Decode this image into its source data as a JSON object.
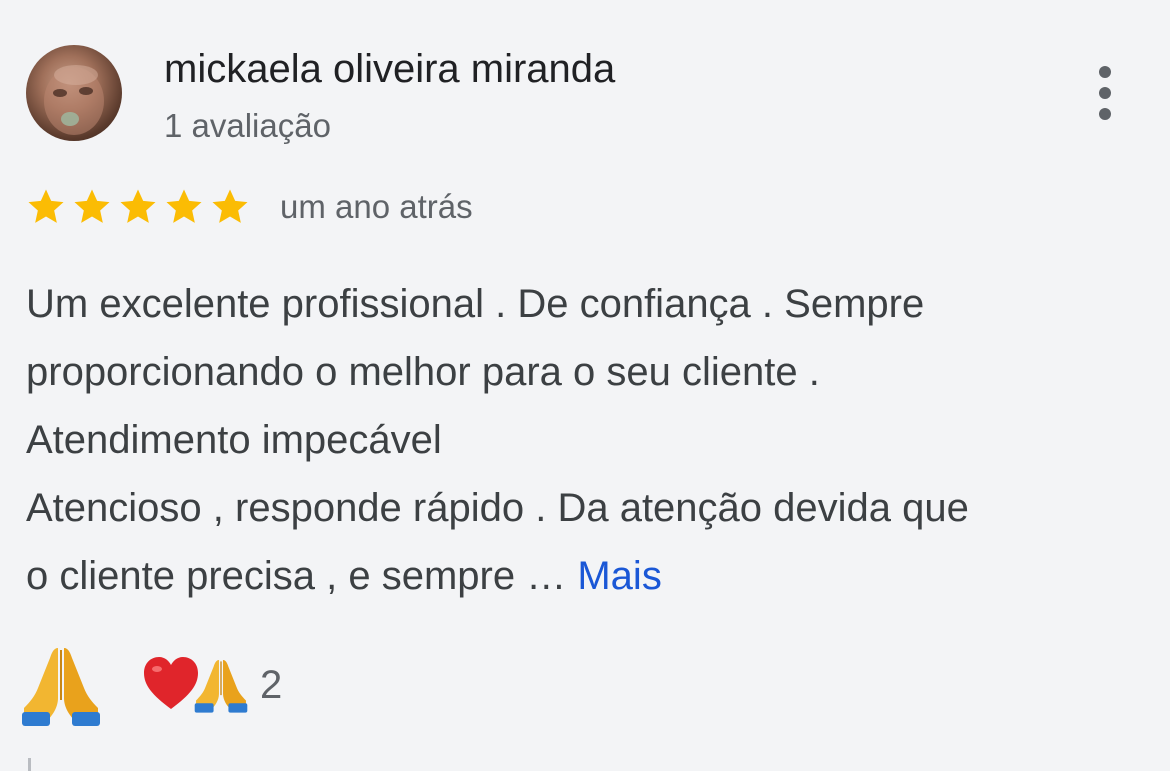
{
  "reviewer": {
    "name": "mickaela oliveira miranda",
    "review_count": "1 avaliação",
    "avatar": "avatar-photo"
  },
  "rating": {
    "stars": 5,
    "max_stars": 5,
    "star_color": "#fbbc04",
    "date": "um ano atrás"
  },
  "review": {
    "lines": [
      "Um excelente profissional . De confiança . Sempre",
      "proporcionando o melhor para o seu cliente .",
      "Atendimento impecável",
      "Atencioso , responde rápido . Da atenção devida que"
    ],
    "last_line": "o cliente precisa , e sempre … ",
    "more_label": "Mais",
    "link_color": "#1a57d6"
  },
  "reactions": {
    "react_icon": "folded-hands-icon",
    "summary_icons": [
      "heart-icon",
      "folded-hands-icon"
    ],
    "count": "2"
  },
  "menu_icon": "more-vert-icon"
}
